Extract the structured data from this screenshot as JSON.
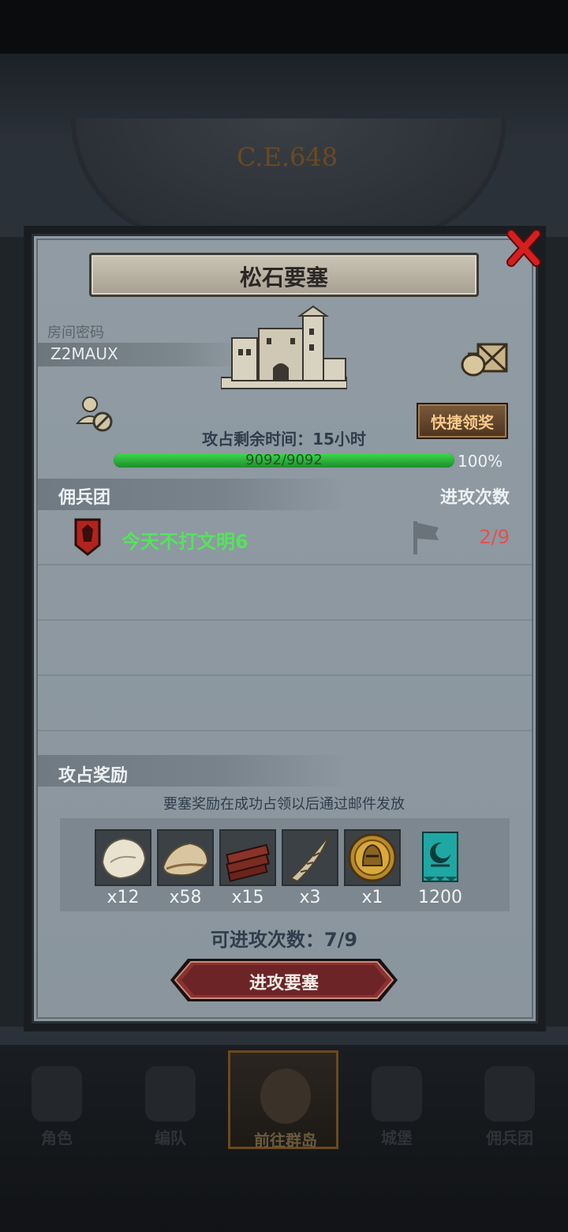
{
  "background": {
    "era_label": "C.E.648"
  },
  "dialog": {
    "title": "松石要塞",
    "room_label": "房间密码",
    "room_code": "Z2MAUX",
    "claim_button": "快捷领奖",
    "time_remaining": "攻占剩余时间：15小时",
    "hp_text": "9092/9092",
    "hp_fraction": 1.0,
    "hp_percent": "100%",
    "mercenary_header": "佣兵团",
    "attack_count_header": "进攻次数",
    "guild": {
      "name": "今天不打文明6",
      "attacks": "2/9"
    },
    "reward_header": "攻占奖励",
    "reward_note": "要塞奖励在成功占领以后通过邮件发放",
    "rewards": [
      {
        "icon": "fur-pelt-icon",
        "qty": "x12"
      },
      {
        "icon": "hide-leather-icon",
        "qty": "x58"
      },
      {
        "icon": "wood-planks-icon",
        "qty": "x15"
      },
      {
        "icon": "horn-icon",
        "qty": "x3"
      },
      {
        "icon": "knight-helmet-coin-icon",
        "qty": "x1"
      },
      {
        "icon": "banner-emblem-icon",
        "qty": "1200"
      }
    ],
    "attempts_text": "可进攻次数：7/9",
    "attack_button": "进攻要塞"
  },
  "bottom_nav": [
    {
      "label": "角色",
      "icon": "knight-icon"
    },
    {
      "label": "编队",
      "icon": "formation-icon"
    },
    {
      "label": "前往群岛",
      "icon": "compass-icon",
      "active": true
    },
    {
      "label": "城堡",
      "icon": "castle-icon"
    },
    {
      "label": "佣兵团",
      "icon": "mercenary-icon"
    }
  ],
  "colors": {
    "hp_green": "#3ed84e",
    "guild_name_green": "#55e35c",
    "attacks_red": "#e25050",
    "close_red": "#d61f1f",
    "claim_text": "#f5c98a"
  }
}
